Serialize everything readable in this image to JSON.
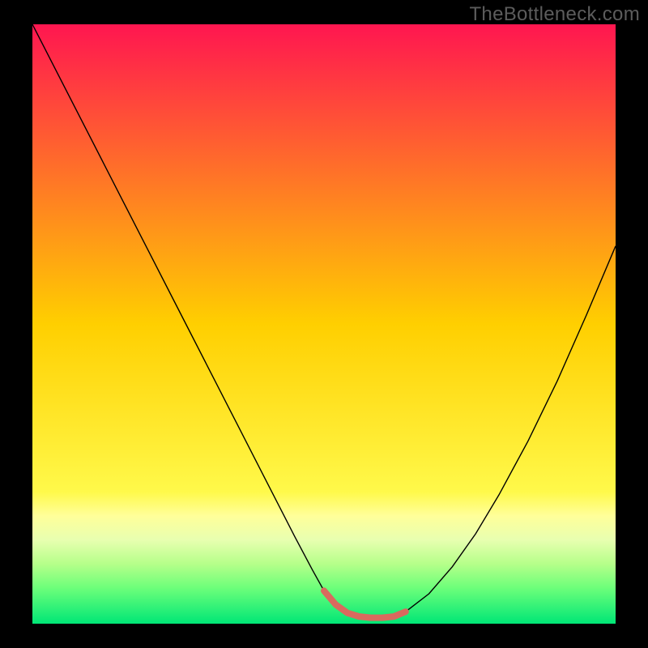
{
  "watermark": "TheBottleneck.com",
  "chart_data": {
    "type": "line",
    "title": "",
    "xlabel": "",
    "ylabel": "",
    "xlim": [
      0,
      100
    ],
    "ylim": [
      0,
      100
    ],
    "grid": false,
    "legend": false,
    "background_gradient": {
      "stops": [
        {
          "offset": 0.0,
          "color": "#ff1650"
        },
        {
          "offset": 0.5,
          "color": "#ffcf00"
        },
        {
          "offset": 0.78,
          "color": "#fff94a"
        },
        {
          "offset": 0.82,
          "color": "#ffff9a"
        },
        {
          "offset": 0.86,
          "color": "#e8ffb0"
        },
        {
          "offset": 0.9,
          "color": "#b6ff8a"
        },
        {
          "offset": 0.94,
          "color": "#6dff7a"
        },
        {
          "offset": 1.0,
          "color": "#00e676"
        }
      ]
    },
    "series": [
      {
        "name": "bottleneck-curve",
        "stroke": "#000000",
        "stroke_width": 1.4,
        "x": [
          0,
          5,
          10,
          15,
          20,
          25,
          30,
          35,
          40,
          45,
          48,
          50,
          52,
          54,
          56,
          58,
          60,
          62,
          64,
          68,
          72,
          76,
          80,
          85,
          90,
          95,
          100
        ],
        "y": [
          100,
          90.5,
          81,
          71.5,
          62,
          52.5,
          43,
          33.5,
          24,
          14.5,
          9,
          5.5,
          3.2,
          1.8,
          1.2,
          1.0,
          1.0,
          1.2,
          2.0,
          5.0,
          9.5,
          15.0,
          21.5,
          30.5,
          40.5,
          51.5,
          63.0
        ]
      },
      {
        "name": "highlight-band",
        "stroke": "#d96a5e",
        "stroke_width": 8,
        "linecap": "round",
        "x": [
          50,
          52,
          54,
          56,
          58,
          60,
          62,
          64
        ],
        "y": [
          5.5,
          3.2,
          1.8,
          1.2,
          1.0,
          1.0,
          1.2,
          2.0
        ]
      }
    ]
  }
}
